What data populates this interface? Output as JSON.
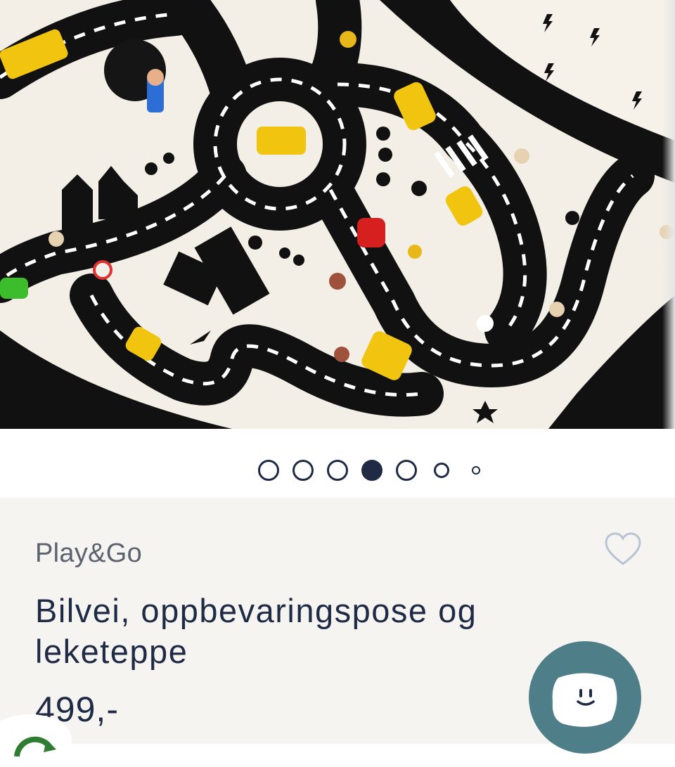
{
  "product": {
    "brand": "Play&Go",
    "title": "Bilvei, oppbevaringspose og leketeppe",
    "price": "499,-"
  },
  "carousel": {
    "dot_count": 7,
    "active_index": 3
  },
  "icons": {
    "wishlist": "heart-outline-icon",
    "chat": "smiley-chat-icon",
    "badge": "recycle-icon"
  },
  "colors": {
    "text": "#1f2a44",
    "brand_text": "#5c6270",
    "panel_background": "#f6f4f1",
    "chat_button": "#4e7f88",
    "road": "#111111",
    "mat": "#f3efe6"
  }
}
